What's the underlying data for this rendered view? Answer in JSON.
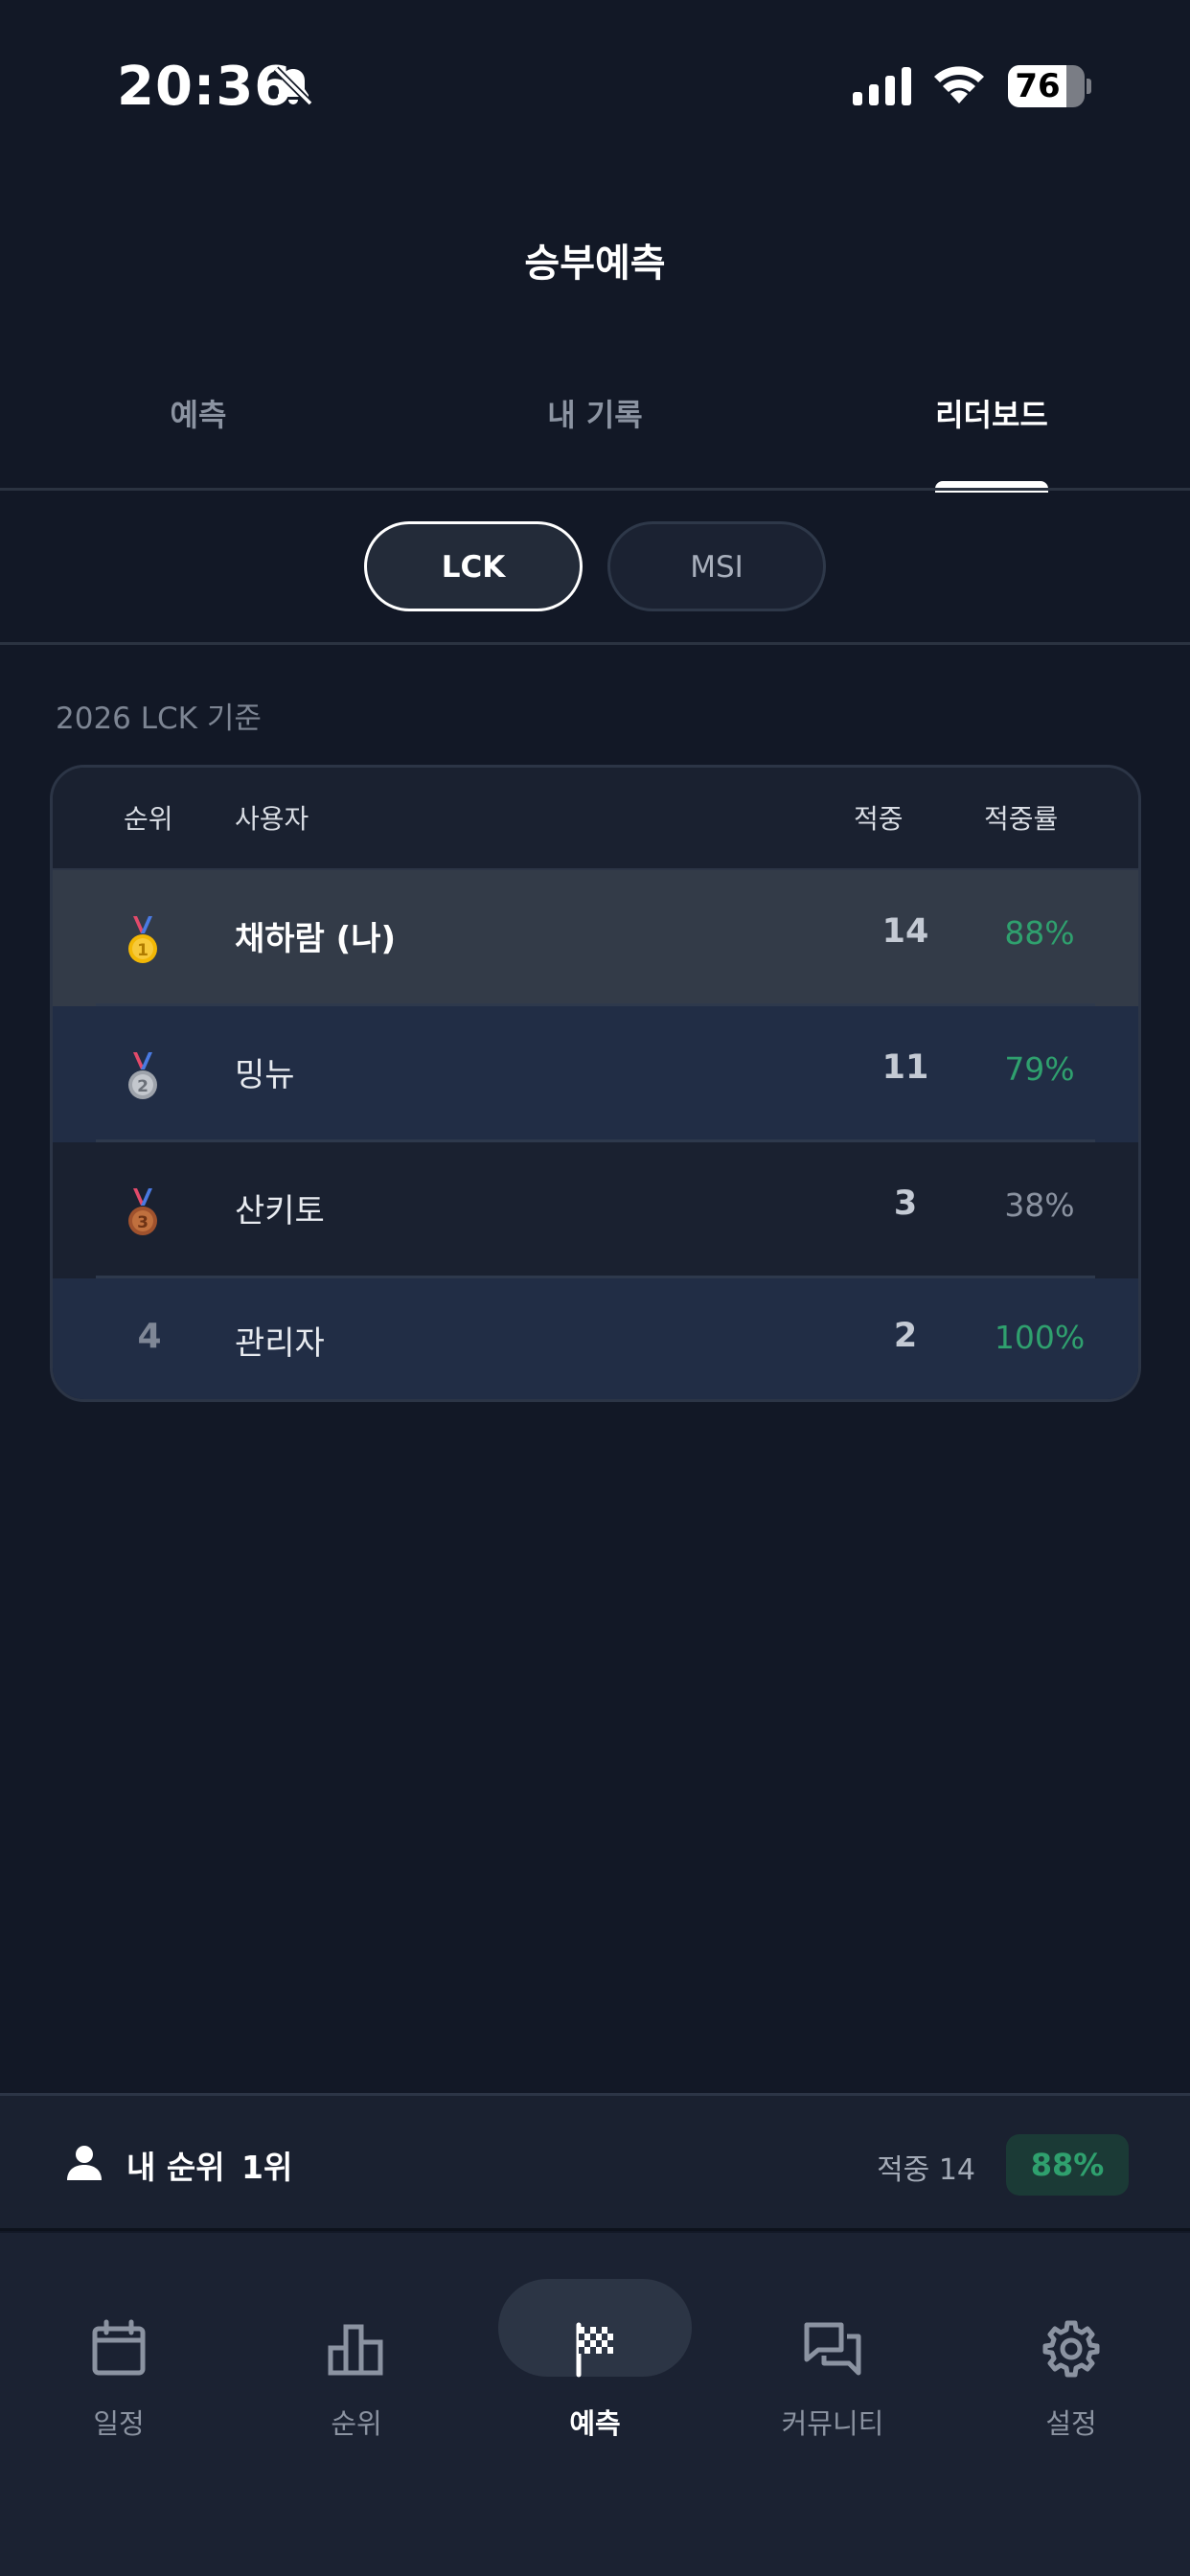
{
  "status_bar": {
    "time": "20:36",
    "battery": "76",
    "battery_level_percent": 76
  },
  "header": {
    "title": "승부예측"
  },
  "tabs": [
    {
      "label": "예측",
      "active": false
    },
    {
      "label": "내 기록",
      "active": false
    },
    {
      "label": "리더보드",
      "active": true
    }
  ],
  "segments": [
    {
      "label": "LCK",
      "selected": true
    },
    {
      "label": "MSI",
      "selected": false
    }
  ],
  "season_caption": "2026 LCK 기준",
  "leaderboard": {
    "columns": {
      "rank": "순위",
      "user": "사용자",
      "hits": "적중",
      "rate": "적중률"
    },
    "rows": [
      {
        "rank": "1",
        "medal": "gold-medal-icon",
        "name": "채하람  (나)",
        "hits": "14",
        "rate": "88%",
        "is_me": true
      },
      {
        "rank": "2",
        "medal": "silver-medal-icon",
        "name": "밍뉴",
        "hits": "11",
        "rate": "79%",
        "is_me": false
      },
      {
        "rank": "3",
        "medal": "bronze-medal-icon",
        "name": "산키토",
        "hits": "3",
        "rate": "38%",
        "is_me": false
      },
      {
        "rank": "4",
        "medal": null,
        "name": "관리자",
        "hits": "2",
        "rate": "100%",
        "is_me": false
      }
    ]
  },
  "my_rank": {
    "label": "내 순위",
    "rank": "1위",
    "hits": "적중 14",
    "rate": "88%"
  },
  "bottom_nav": [
    {
      "label": "일정",
      "icon": "calendar-icon",
      "active": false
    },
    {
      "label": "순위",
      "icon": "bar-chart-icon",
      "active": false
    },
    {
      "label": "예측",
      "icon": "checkered-flag-icon",
      "active": true
    },
    {
      "label": "커뮤니티",
      "icon": "chat-bubbles-icon",
      "active": false
    },
    {
      "label": "설정",
      "icon": "gear-icon",
      "active": false
    }
  ],
  "colors": {
    "background": "#121826",
    "accent_green": "#2fa06e",
    "card": "#1a2130",
    "highlight_row": "#333b48"
  }
}
